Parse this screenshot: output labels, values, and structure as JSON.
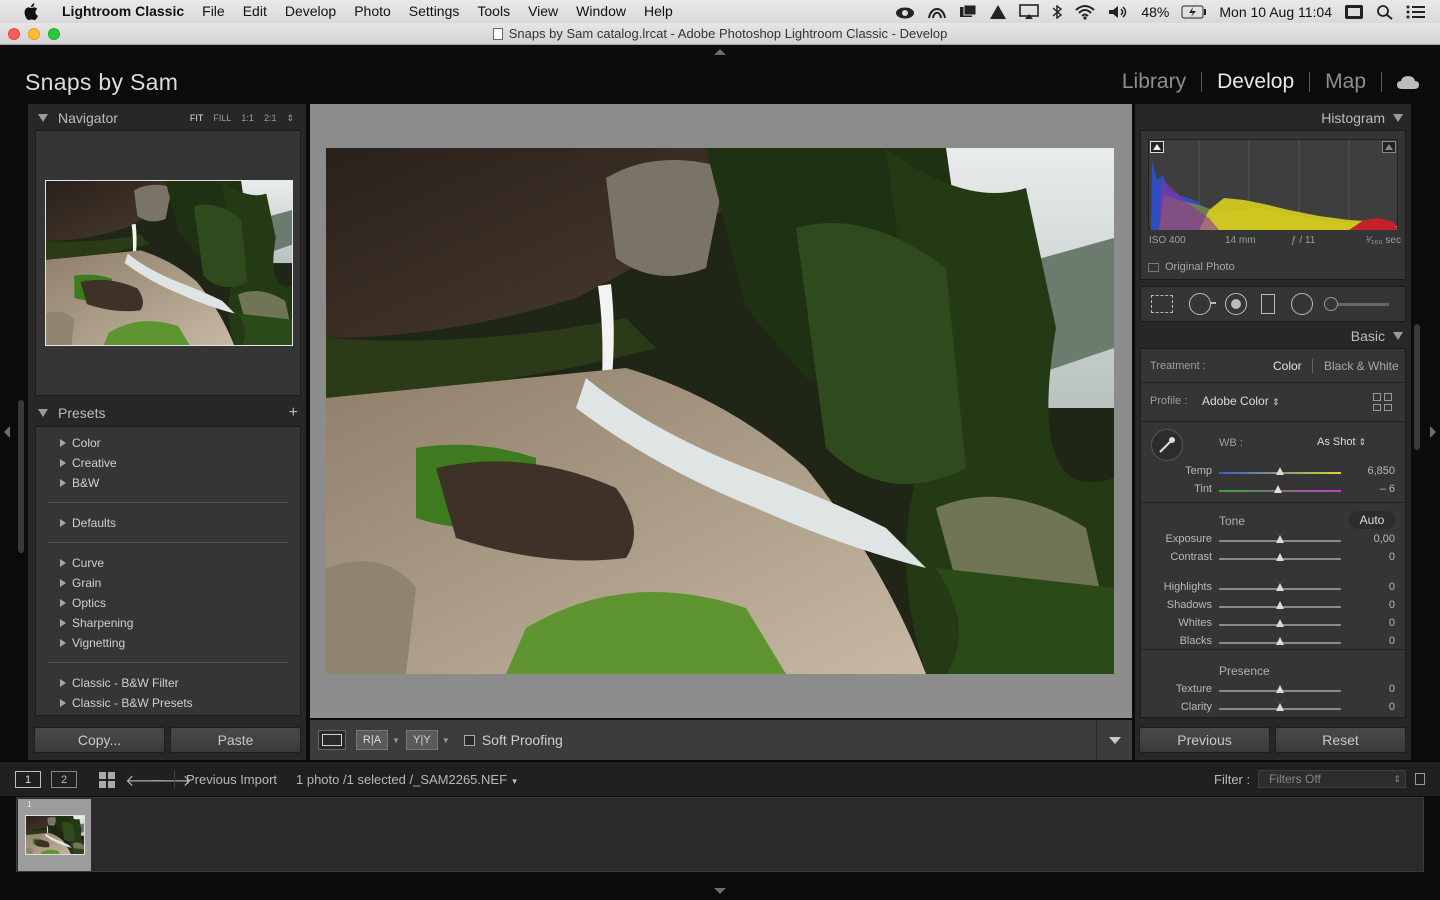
{
  "menubar": {
    "app_name": "Lightroom Classic",
    "menus": [
      "File",
      "Edit",
      "Develop",
      "Photo",
      "Settings",
      "Tools",
      "View",
      "Window",
      "Help"
    ],
    "battery": "48%",
    "clock": "Mon 10 Aug  11:04"
  },
  "window": {
    "title": "Snaps by Sam catalog.lrcat - Adobe Photoshop Lightroom Classic - Develop"
  },
  "identity": {
    "name": "Snaps by Sam"
  },
  "modules": [
    "Library",
    "Develop",
    "Map"
  ],
  "active_module": "Develop",
  "navigator": {
    "title": "Navigator",
    "zoom_options": [
      "FIT",
      "FILL",
      "1:1",
      "2:1"
    ],
    "active_zoom": "FIT"
  },
  "presets": {
    "title": "Presets",
    "groups": [
      [
        "Color",
        "Creative",
        "B&W"
      ],
      [
        "Defaults"
      ],
      [
        "Curve",
        "Grain",
        "Optics",
        "Sharpening",
        "Vignetting"
      ],
      [
        "Classic - B&W Filter",
        "Classic - B&W Presets"
      ]
    ]
  },
  "left_buttons": {
    "copy": "Copy...",
    "paste": "Paste"
  },
  "toolbar": {
    "soft_proofing": "Soft Proofing",
    "before_after_1": "R|A",
    "before_after_2": "Y|Y"
  },
  "histogram": {
    "title": "Histogram",
    "iso": "ISO 400",
    "focal": "14 mm",
    "aperture": "ƒ / 11",
    "shutter": "¹⁄₁₆₀ sec",
    "original_photo": "Original Photo"
  },
  "basic": {
    "title": "Basic",
    "treatment_label": "Treatment :",
    "treatment_color": "Color",
    "treatment_bw": "Black & White",
    "profile_label": "Profile :",
    "profile_value": "Adobe Color",
    "wb_label": "WB :",
    "wb_value": "As Shot",
    "temp": {
      "label": "Temp",
      "value": "6,850",
      "level": 0.5
    },
    "tint": {
      "label": "Tint",
      "value": "– 6",
      "level": 0.48
    },
    "tone_label": "Tone",
    "auto_label": "Auto",
    "tone_sliders": [
      {
        "label": "Exposure",
        "value": "0,00"
      },
      {
        "label": "Contrast",
        "value": "0"
      }
    ],
    "tone_sliders2": [
      {
        "label": "Highlights",
        "value": "0"
      },
      {
        "label": "Shadows",
        "value": "0"
      },
      {
        "label": "Whites",
        "value": "0"
      },
      {
        "label": "Blacks",
        "value": "0"
      }
    ],
    "presence_label": "Presence",
    "presence_sliders": [
      {
        "label": "Texture",
        "value": "0"
      },
      {
        "label": "Clarity",
        "value": "0"
      }
    ]
  },
  "right_buttons": {
    "previous": "Previous",
    "reset": "Reset"
  },
  "filmstrip": {
    "screen1": "1",
    "screen2": "2",
    "source": "Previous Import",
    "info": "1 photo /1 selected /_SAM2265.NEF",
    "filter_label": "Filter :",
    "filter_value": "Filters Off",
    "thumb_index": "1"
  },
  "colors": {
    "accent": "#e9e9e9",
    "panel": "#353535",
    "background": "#0b0b0b"
  }
}
